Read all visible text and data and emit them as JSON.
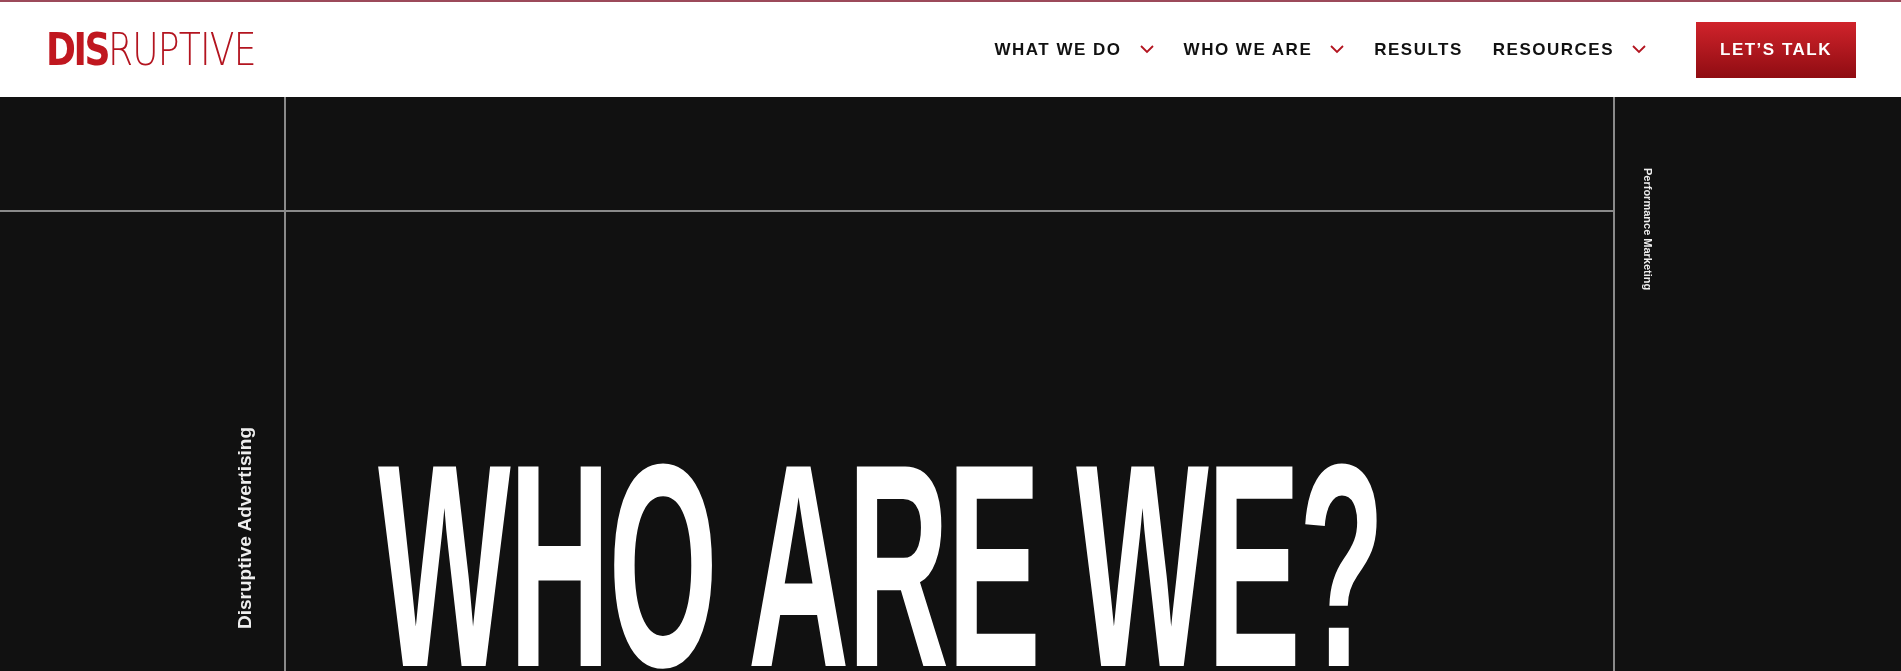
{
  "header": {
    "logo": "**DIS**RUPTIVE",
    "nav": [
      {
        "label": "WHAT WE DO",
        "has_dropdown": true
      },
      {
        "label": "WHO WE ARE",
        "has_dropdown": true
      },
      {
        "label": "RESULTS",
        "has_dropdown": false
      },
      {
        "label": "RESOURCES",
        "has_dropdown": true
      }
    ],
    "cta": "LET’S TALK"
  },
  "hero": {
    "left_label": "Disruptive Advertising",
    "right_label": "Performance Marketing",
    "heading": "WHO ARE WE?"
  }
}
